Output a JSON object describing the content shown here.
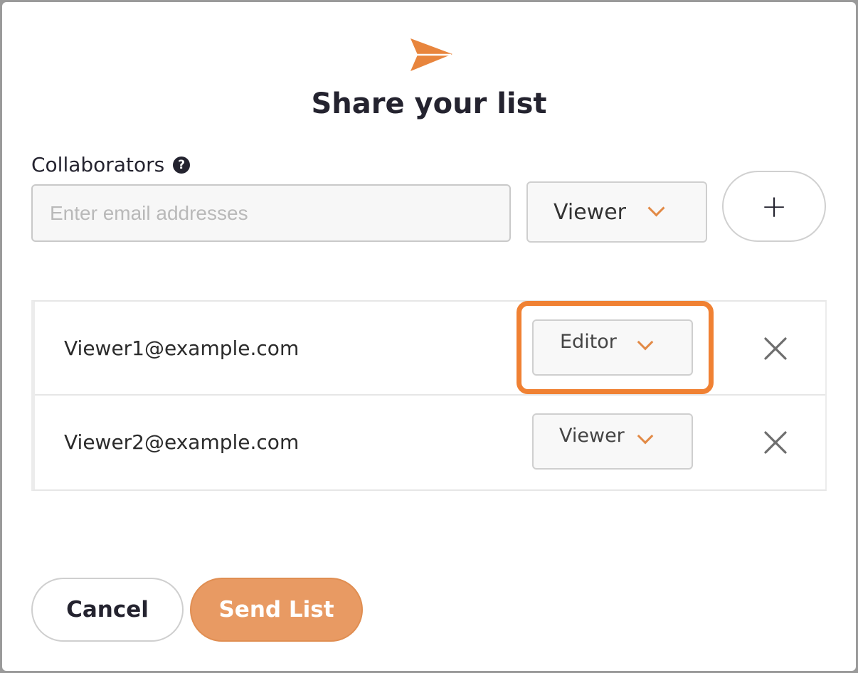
{
  "dialog": {
    "title": "Share your list",
    "icon": "paper-plane-icon",
    "accent_color": "#E8853D"
  },
  "collaborators": {
    "label": "Collaborators",
    "help_icon": "question-circle-icon",
    "help_glyph": "?",
    "email_placeholder": "Enter email addresses",
    "email_value": "",
    "role_select": "Viewer",
    "add_button_label": "+"
  },
  "collaborator_list": [
    {
      "email": "Viewer1@example.com",
      "role": "Editor",
      "highlighted": true,
      "highlight_color": "#F08133"
    },
    {
      "email": "Viewer2@example.com",
      "role": "Viewer",
      "highlighted": false
    }
  ],
  "footer": {
    "cancel_label": "Cancel",
    "send_label": "Send List",
    "send_color": "#E89A63"
  }
}
